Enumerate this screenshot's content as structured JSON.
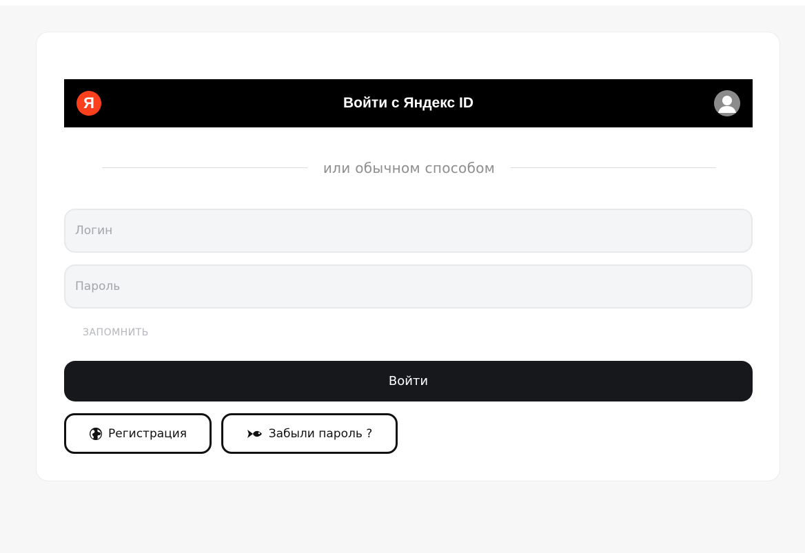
{
  "yandex": {
    "logo_letter": "Я",
    "button_label": "Войти с Яндекс ID",
    "logo_color": "#fc3f1d"
  },
  "divider": {
    "text": "или обычном способом"
  },
  "form": {
    "login_placeholder": "Логин",
    "password_placeholder": "Пароль",
    "remember_label": "ЗАПОМНИТЬ",
    "submit_label": "Войти"
  },
  "links": {
    "register_label": "Регистрация",
    "register_icon": "globe-icon",
    "forgot_label": "Забыли пароль ?",
    "forgot_icon": "fish-icon"
  },
  "colors": {
    "page_background": "#f7f7f7",
    "card_background": "#ffffff",
    "yandex_bar": "#000000",
    "primary_button": "#17181c"
  }
}
